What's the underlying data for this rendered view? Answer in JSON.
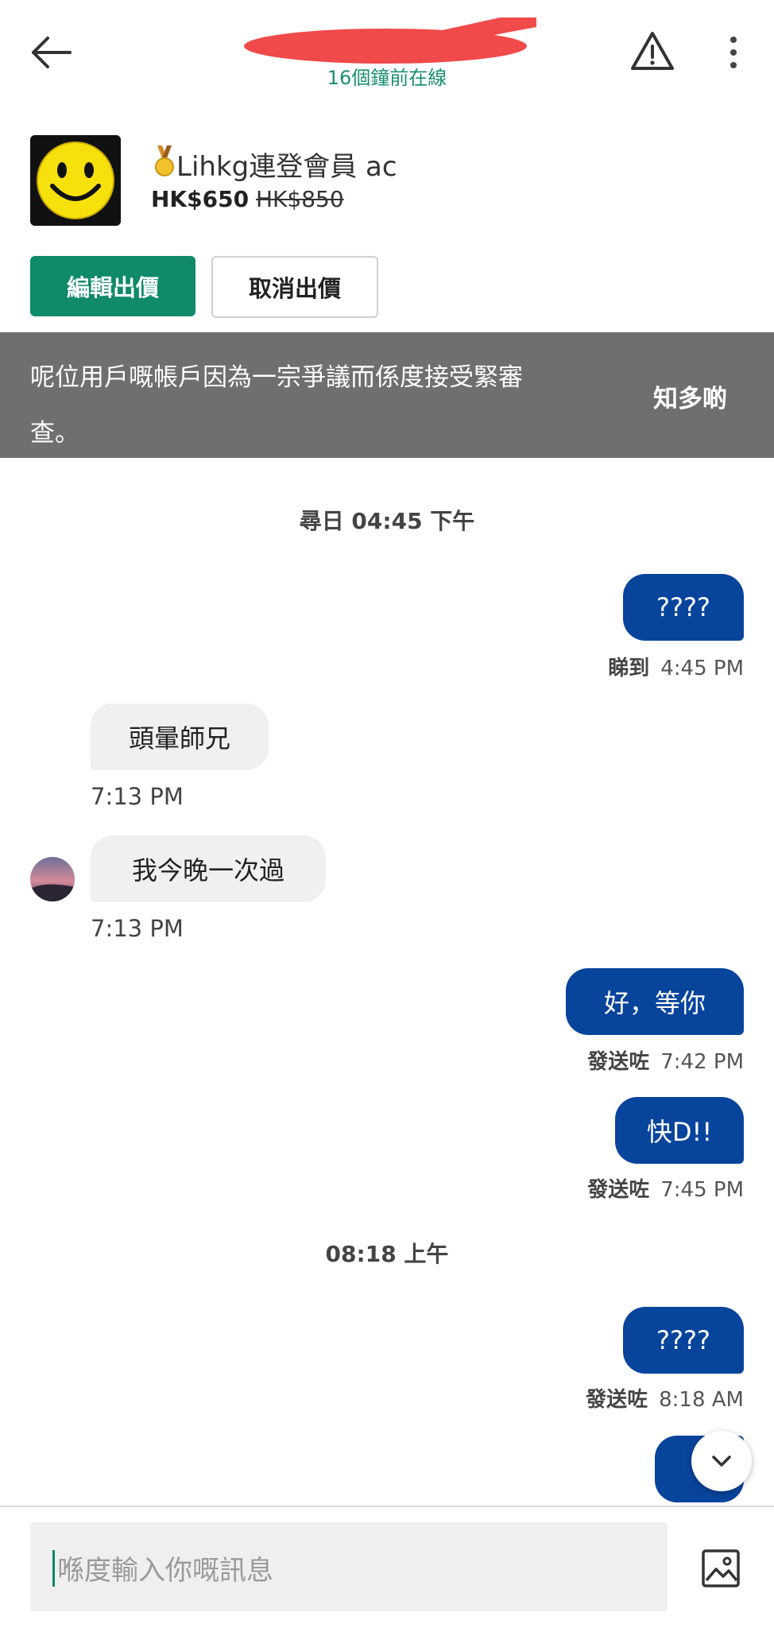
{
  "header": {
    "back_icon": "arrow-left-icon",
    "status": "16個鐘前在線",
    "report_icon": "warning-triangle-icon",
    "more_icon": "more-vertical-icon"
  },
  "listing": {
    "title": "Lihkg連登會員 ac",
    "price": "HK$650",
    "original_price": "HK$850"
  },
  "actions": {
    "edit_offer": "編輯出價",
    "cancel_offer": "取消出價"
  },
  "banner": {
    "message": "呢位用戶嘅帳戶因為一宗爭議而係度接受緊審查。",
    "link": "知多啲"
  },
  "chat": {
    "date_1": "尋日 04:45 下午",
    "date_2": "08:18 上午",
    "messages": [
      {
        "dir": "out",
        "text": "????",
        "status": "睇到",
        "time": "4:45 PM"
      },
      {
        "dir": "in",
        "text": "頭暈師兄",
        "time": "7:13 PM"
      },
      {
        "dir": "in",
        "text": "我今晚一次過",
        "time": "7:13 PM"
      },
      {
        "dir": "out",
        "text": "好，等你",
        "status": "發送咗",
        "time": "7:42 PM"
      },
      {
        "dir": "out",
        "text": "快D!!",
        "status": "發送咗",
        "time": "7:45 PM"
      },
      {
        "dir": "out",
        "text": "????",
        "status": "發送咗",
        "time": "8:18 AM"
      }
    ]
  },
  "input": {
    "placeholder": "喺度輸入你嘅訊息",
    "image_icon": "image-icon"
  },
  "colors": {
    "brand_green": "#0f8a6b",
    "outgoing_bubble": "#07449c",
    "banner_bg": "#6e6f71"
  }
}
